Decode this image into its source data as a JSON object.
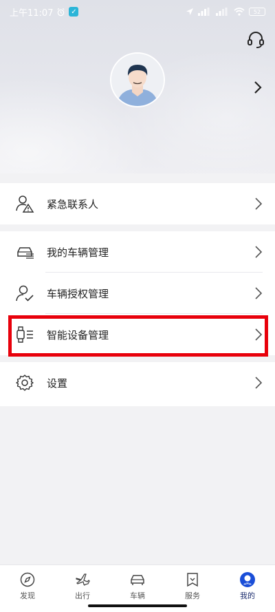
{
  "status_bar": {
    "time": "上午11:07",
    "battery": "52"
  },
  "menu": {
    "emergency": "紧急联系人",
    "my_vehicles": "我的车辆管理",
    "vehicle_auth": "车辆授权管理",
    "smart_devices": "智能设备管理",
    "settings": "设置"
  },
  "bottom_nav": {
    "items": [
      {
        "label": "发现",
        "icon": "compass-icon"
      },
      {
        "label": "出行",
        "icon": "airplane-icon"
      },
      {
        "label": "车辆",
        "icon": "car-icon"
      },
      {
        "label": "服务",
        "icon": "bookmark-icon"
      },
      {
        "label": "我的",
        "icon": "profile-icon"
      }
    ],
    "active": "我的"
  },
  "colors": {
    "highlight": "#e8000b",
    "active_nav": "#1a2b6d"
  }
}
